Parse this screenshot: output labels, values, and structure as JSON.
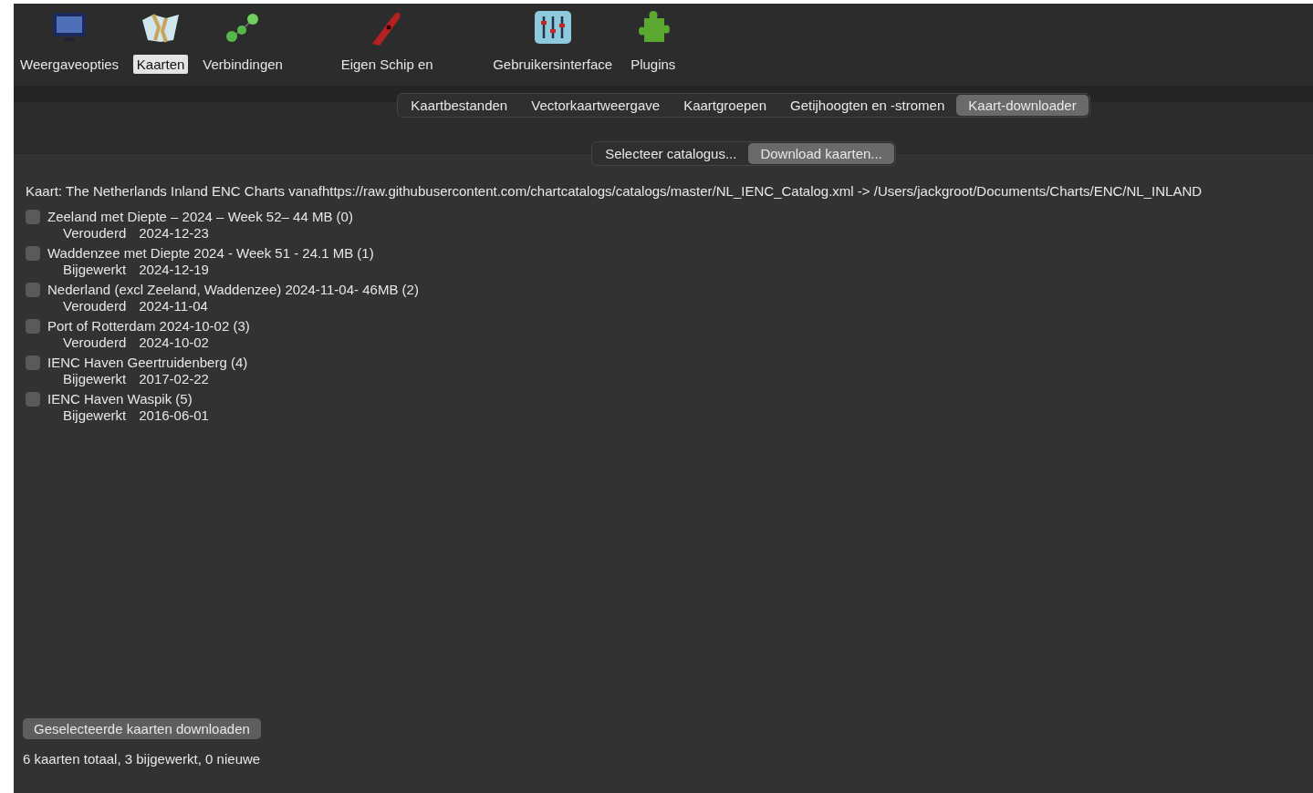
{
  "toolbar": [
    {
      "kind": "monitor",
      "label": "Weergaveopties",
      "selected": false
    },
    {
      "kind": "map",
      "label": "Kaarten",
      "selected": true
    },
    {
      "kind": "connections",
      "label": "Verbindingen",
      "selected": false
    },
    {
      "kind": "ship",
      "label": "Eigen Schip en",
      "selected": false
    },
    {
      "kind": "sliders",
      "label": "Gebruikersinterface",
      "selected": false
    },
    {
      "kind": "puzzle",
      "label": "Plugins",
      "selected": false
    }
  ],
  "tabs": [
    {
      "label": "Kaartbestanden",
      "selected": false
    },
    {
      "label": "Vectorkaartweergave",
      "selected": false
    },
    {
      "label": "Kaartgroepen",
      "selected": false
    },
    {
      "label": "Getijhoogten en -stromen",
      "selected": false
    },
    {
      "label": "Kaart-downloader",
      "selected": true
    }
  ],
  "mode_buttons": [
    {
      "label": "Selecteer catalogus...",
      "selected": false
    },
    {
      "label": "Download kaarten...",
      "selected": true
    }
  ],
  "catalog_line": "Kaart: The Netherlands Inland ENC Charts vanafhttps://raw.githubusercontent.com/chartcatalogs/catalogs/master/NL_IENC_Catalog.xml -> /Users/jackgroot/Documents/Charts/ENC/NL_INLAND",
  "charts": [
    {
      "title": "Zeeland met Diepte – 2024 – Week 52– 44 MB (0)",
      "status": "Verouderd",
      "date": "2024-12-23",
      "checked": false
    },
    {
      "title": "Waddenzee met Diepte 2024 - Week 51 - 24.1 MB (1)",
      "status": "Bijgewerkt",
      "date": "2024-12-19",
      "checked": false
    },
    {
      "title": "Nederland (excl Zeeland, Waddenzee) 2024-11-04- 46MB (2)",
      "status": "Verouderd",
      "date": "2024-11-04",
      "checked": false
    },
    {
      "title": "Port of Rotterdam 2024-10-02 (3)",
      "status": "Verouderd",
      "date": "2024-10-02",
      "checked": false
    },
    {
      "title": "IENC Haven Geertruidenberg (4)",
      "status": "Bijgewerkt",
      "date": "2017-02-22",
      "checked": false
    },
    {
      "title": "IENC Haven Waspik (5)",
      "status": "Bijgewerkt",
      "date": "2016-06-01",
      "checked": false
    }
  ],
  "download_button": "Geselecteerde kaarten downloaden",
  "summary": "6 kaarten totaal, 3 bijgewerkt, 0 nieuwe"
}
